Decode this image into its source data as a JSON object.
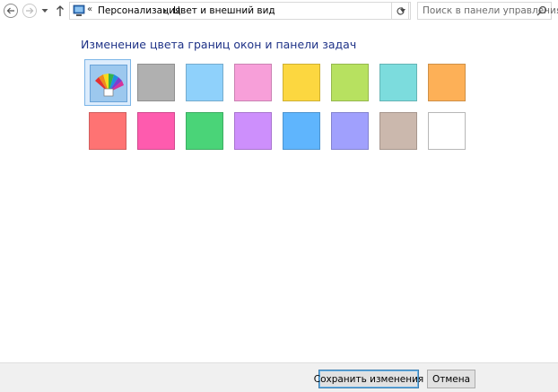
{
  "navigation": {
    "breadcrumb_overflow": "«",
    "breadcrumbs": [
      "Персонализация",
      "Цвет и внешний вид"
    ],
    "search_placeholder": "Поиск в панели управления"
  },
  "main": {
    "heading": "Изменение цвета границ окон и панели задач",
    "selected_index": 0,
    "swatches": [
      {
        "name": "automatic",
        "color": "#9cc8ee"
      },
      {
        "name": "gray",
        "color": "#b0b0b0"
      },
      {
        "name": "light-blue",
        "color": "#8fd1fb"
      },
      {
        "name": "pink",
        "color": "#f79fd9"
      },
      {
        "name": "yellow",
        "color": "#fcd740"
      },
      {
        "name": "lime",
        "color": "#b7e160"
      },
      {
        "name": "turquoise",
        "color": "#7cdcdd"
      },
      {
        "name": "orange",
        "color": "#fdb057"
      },
      {
        "name": "red",
        "color": "#fe7373"
      },
      {
        "name": "magenta",
        "color": "#fe5bae"
      },
      {
        "name": "green",
        "color": "#4ad478"
      },
      {
        "name": "violet",
        "color": "#cd8ffc"
      },
      {
        "name": "blue",
        "color": "#5fb5fd"
      },
      {
        "name": "periwinkle",
        "color": "#a0a0fd"
      },
      {
        "name": "taupe",
        "color": "#cbb8ad"
      },
      {
        "name": "white",
        "color": "#ffffff"
      }
    ]
  },
  "footer": {
    "save_label": "Сохранить изменения",
    "cancel_label": "Отмена"
  }
}
